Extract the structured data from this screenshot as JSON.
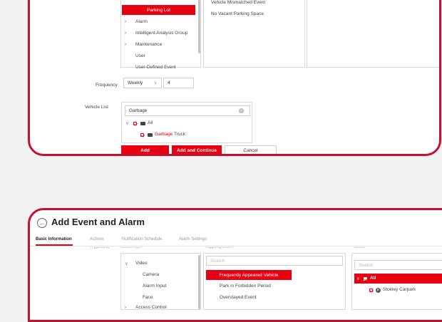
{
  "top_form": {
    "trigger_event_items": [
      "Vehicle Mismatched Event",
      "No Vacant Parking Space"
    ],
    "source_type_items": [
      {
        "label": "Parking Lot",
        "selected": true,
        "arrow": false
      },
      {
        "label": "Alarm",
        "arrow": true
      },
      {
        "label": "Intelligent Analysis Group",
        "arrow": true
      },
      {
        "label": "Maintenance",
        "arrow": true
      },
      {
        "label": "User",
        "arrow": false
      },
      {
        "label": "User-Defined Event",
        "arrow": false
      }
    ],
    "frequency": {
      "label": "Frequency",
      "select_value": "Weekly",
      "count_value": "4"
    },
    "vehicle_list": {
      "label": "Vehicle List",
      "search_value": "Garbage",
      "all_label": "All",
      "item_highlight": "Garbage",
      "item_rest": " Truck"
    },
    "buttons": {
      "add": "Add",
      "add_continue": "Add and Continue",
      "cancel": "Cancel"
    }
  },
  "bottom_form": {
    "title": "Add Event and Alarm",
    "tabs": [
      "Basic Information",
      "Actions",
      "Notification Schedule",
      "Alarm Settings"
    ],
    "partial_labels": {
      "triggered_by": "Triggered by",
      "source_type": "Source Type",
      "triggering_event": "Triggering Event",
      "source": "Source"
    },
    "source_types": {
      "video": "Video",
      "children": [
        "Camera",
        "Alarm Input",
        "Face"
      ],
      "access_control": "Access Control"
    },
    "event_search_placeholder": "Search",
    "events": [
      "Frequently Appeared Vehicle",
      "Park in Forbidden Period",
      "Overstayed Event"
    ],
    "source_search_placeholder": "Search",
    "source_all": "All",
    "source_item": "Stokley Carpark"
  },
  "colors": {
    "accent": "#e60012",
    "frame": "#c8102e"
  }
}
